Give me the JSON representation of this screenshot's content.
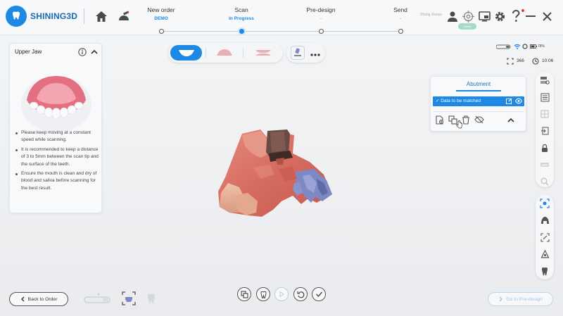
{
  "app": {
    "logo_text": "SHINING3D"
  },
  "header": {
    "steps": [
      {
        "title": "New order",
        "sub": "DEMO"
      },
      {
        "title": "Scan",
        "sub": "In Progress"
      },
      {
        "title": "Pre-design",
        "sub": "-"
      },
      {
        "title": "Send",
        "sub": "-"
      }
    ],
    "user_name": "Shang Xiaoyu",
    "user_badge": "Online"
  },
  "jaw_panel": {
    "title": "Upper Jaw",
    "tips": [
      "Please keep moving at a constant speed while scanning.",
      "It is recommended to keep a distance of 3 to 5mm between the scan tip and the surface of the teeth.",
      "Ensure the mouth is clean and dry of blood and saliva before scanning for the best result."
    ]
  },
  "status": {
    "battery": "78%",
    "count": "366",
    "time": "10:06"
  },
  "abutment": {
    "tab": "Abutment",
    "row_label": "Data to be matched"
  },
  "footer": {
    "back_label": "Back to Order",
    "next_label": "Go to Pre-design"
  },
  "colors": {
    "accent": "#1e88e5",
    "gum": "#d9776b",
    "abutment_blue": "#7d88c4"
  },
  "icons": {
    "header": [
      "home-icon",
      "scanner-device-icon",
      "user-icon",
      "target-icon",
      "screen-icon",
      "settings-icon",
      "help-icon",
      "minimize-icon",
      "close-icon"
    ],
    "right_toolbar_top": [
      "layer-view-icon",
      "fit-view-icon",
      "grid-view-icon",
      "import-icon",
      "lock-icon",
      "ruler-icon",
      "zoom-icon"
    ],
    "right_toolbar_bottom": [
      "scan-mode-icon",
      "cast-icon",
      "trim-icon",
      "tooth-mark-icon",
      "tooth-icon"
    ]
  }
}
